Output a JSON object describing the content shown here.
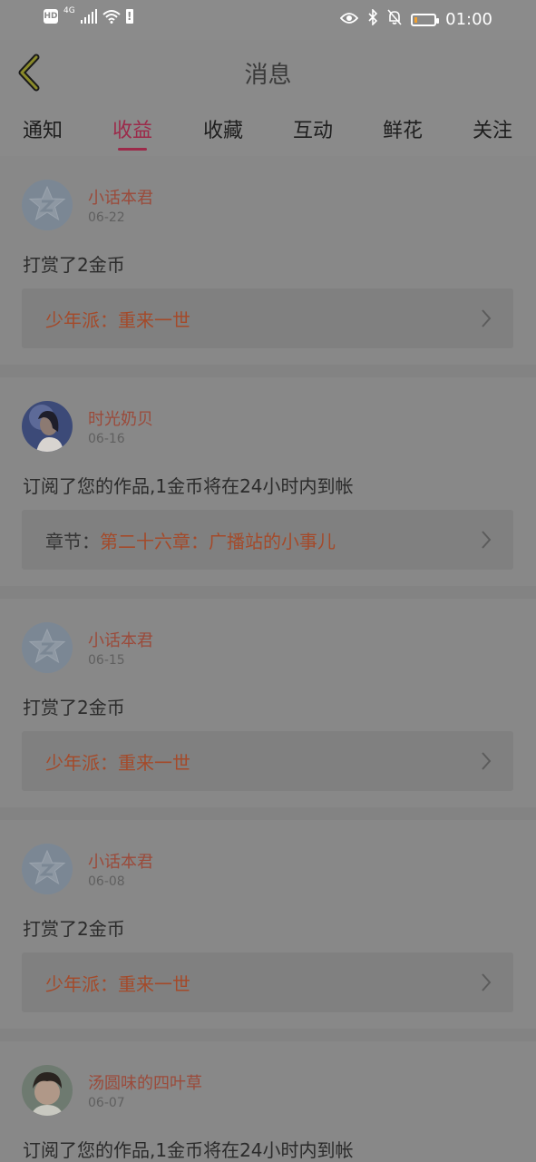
{
  "status_bar": {
    "hd_label": "HD",
    "network_label": "4G",
    "time": "01:00",
    "battery_level": 0.15,
    "icons": [
      "signal-icon",
      "wifi-icon",
      "alert-icon",
      "eye-icon",
      "bluetooth-icon",
      "mute-bell-icon",
      "battery-icon"
    ]
  },
  "header": {
    "title": "消息",
    "back_icon": "chevron-left-icon"
  },
  "tabs": [
    {
      "label": "通知"
    },
    {
      "label": "收益",
      "active": true
    },
    {
      "label": "收藏"
    },
    {
      "label": "互动"
    },
    {
      "label": "鲜花"
    },
    {
      "label": "关注"
    }
  ],
  "messages": [
    {
      "username": "小话本君",
      "date": "06-22",
      "text": "打赏了2金币",
      "link_prefix": "",
      "link_text": "少年派：重来一世",
      "avatar": "default-star-avatar"
    },
    {
      "username": "时光奶贝",
      "date": "06-16",
      "text": "订阅了您的作品,1金币将在24小时内到帐",
      "link_prefix": "章节：",
      "link_text": "第二十六章：广播站的小事儿",
      "avatar": "photo-avatar"
    },
    {
      "username": "小话本君",
      "date": "06-15",
      "text": "打赏了2金币",
      "link_prefix": "",
      "link_text": "少年派：重来一世",
      "avatar": "default-star-avatar"
    },
    {
      "username": "小话本君",
      "date": "06-08",
      "text": "打赏了2金币",
      "link_prefix": "",
      "link_text": "少年派：重来一世",
      "avatar": "default-star-avatar"
    },
    {
      "username": "汤圆味的四叶草",
      "date": "06-07",
      "text": "订阅了您的作品,1金币将在24小时内到帐",
      "link_prefix": "",
      "link_text": "",
      "avatar": "photo-avatar"
    }
  ],
  "colors": {
    "accent": "#9c2a4a",
    "username": "#9b4a3a",
    "link": "#a44a2a"
  }
}
